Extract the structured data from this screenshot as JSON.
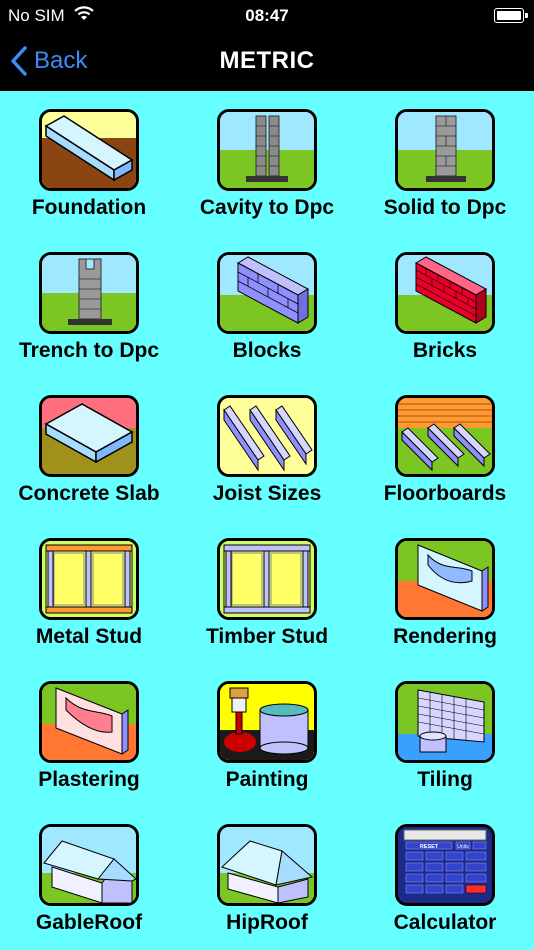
{
  "status_bar": {
    "carrier": "No SIM",
    "time": "08:47"
  },
  "nav": {
    "back_label": "Back",
    "title": "METRIC"
  },
  "menu": [
    {
      "label": "Foundation",
      "icon": "foundation-icon"
    },
    {
      "label": "Cavity to Dpc",
      "icon": "cavity-wall-icon"
    },
    {
      "label": "Solid to Dpc",
      "icon": "solid-wall-icon"
    },
    {
      "label": "Trench to Dpc",
      "icon": "trench-wall-icon"
    },
    {
      "label": "Blocks",
      "icon": "blocks-icon"
    },
    {
      "label": "Bricks",
      "icon": "bricks-icon"
    },
    {
      "label": "Concrete Slab",
      "icon": "concrete-slab-icon"
    },
    {
      "label": "Joist Sizes",
      "icon": "joists-icon"
    },
    {
      "label": "Floorboards",
      "icon": "floorboards-icon"
    },
    {
      "label": "Metal Stud",
      "icon": "metal-stud-icon"
    },
    {
      "label": "Timber Stud",
      "icon": "timber-stud-icon"
    },
    {
      "label": "Rendering",
      "icon": "rendering-icon"
    },
    {
      "label": "Plastering",
      "icon": "plastering-icon"
    },
    {
      "label": "Painting",
      "icon": "painting-icon"
    },
    {
      "label": "Tiling",
      "icon": "tiling-icon"
    },
    {
      "label": "GableRoof",
      "icon": "gable-roof-icon"
    },
    {
      "label": "HipRoof",
      "icon": "hip-roof-icon"
    },
    {
      "label": "Calculator",
      "icon": "calculator-icon"
    }
  ],
  "calculator_keys": [
    "RESET",
    "Units"
  ],
  "colors": {
    "background": "#66ffff",
    "bars": "#000000",
    "back_accent": "#3a8df5",
    "sky": "#9fe8ff",
    "grass": "#7cc623",
    "soil": "#8b4513",
    "brick": "#e8002a",
    "block": "#8f8fff"
  }
}
